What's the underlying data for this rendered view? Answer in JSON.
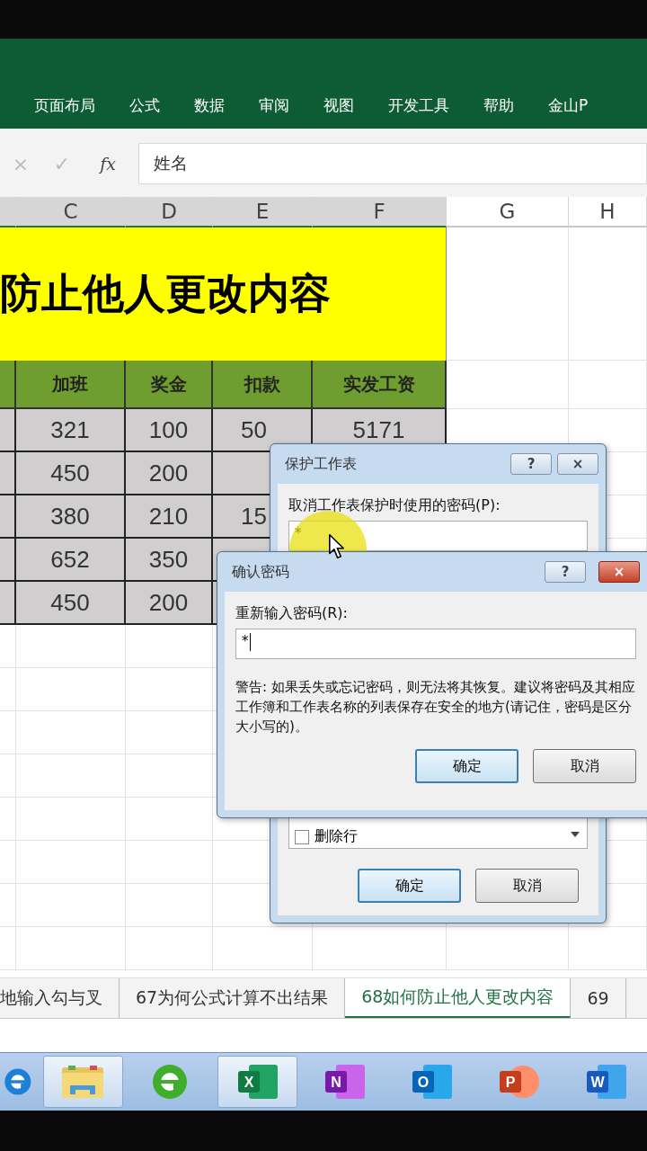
{
  "ribbon": {
    "tabs": [
      {
        "label": "页面布局",
        "selected": false
      },
      {
        "label": "公式",
        "selected": false
      },
      {
        "label": "数据",
        "selected": false
      },
      {
        "label": "审阅",
        "selected": false
      },
      {
        "label": "视图",
        "selected": false
      },
      {
        "label": "开发工具",
        "selected": false
      },
      {
        "label": "帮助",
        "selected": false
      },
      {
        "label": "金山P",
        "selected": false
      }
    ]
  },
  "formula_bar": {
    "cancel": "×",
    "enter": "✓",
    "function": "fx",
    "value": "姓名"
  },
  "columns": [
    "C",
    "D",
    "E",
    "F",
    "G",
    "H"
  ],
  "sheet": {
    "title": "防止他人更改内容",
    "headers": [
      "加班",
      "奖金",
      "扣款",
      "实发工资"
    ],
    "rows": [
      [
        "321",
        "100",
        "50",
        "5171"
      ],
      [
        "450",
        "200"
      ],
      [
        "380",
        "210",
        "15"
      ],
      [
        "652",
        "350"
      ],
      [
        "450",
        "200"
      ]
    ]
  },
  "protect_dialog": {
    "title": "保护工作表",
    "help": "?",
    "close": "×",
    "password_label": "取消工作表保护时使用的密码(P):",
    "password_value": "*",
    "options": [
      {
        "label": "删除行",
        "checked": false
      }
    ],
    "buttons": [
      {
        "label": "确定",
        "default": true
      },
      {
        "label": "取消",
        "default": false
      }
    ]
  },
  "confirm_dialog": {
    "title": "确认密码",
    "help": "?",
    "close": "×",
    "password_label": "重新输入密码(R):",
    "password_value": "*",
    "warning": "警告: 如果丢失或忘记密码，则无法将其恢复。建议将密码及其相应工作簿和工作表名称的列表保存在安全的地方(请记住，密码是区分大小写的)。",
    "buttons": [
      {
        "label": "确定",
        "default": true
      },
      {
        "label": "取消",
        "default": false
      }
    ]
  },
  "sheet_tabs": [
    {
      "label": "地输入勾与叉",
      "selected": false
    },
    {
      "label": "67为何公式计算不出结果",
      "selected": false
    },
    {
      "label": "68如何防止他人更改内容",
      "selected": true
    },
    {
      "label": "69",
      "selected": false
    }
  ],
  "taskbar": [
    {
      "kind": "ie",
      "selected": false
    },
    {
      "kind": "folder",
      "selected": true
    },
    {
      "kind": "browser360",
      "selected": false
    },
    {
      "kind": "excel",
      "letter": "X",
      "selected": true
    },
    {
      "kind": "onenote",
      "letter": "N",
      "selected": false
    },
    {
      "kind": "outlook",
      "letter": "O",
      "selected": false
    },
    {
      "kind": "powerpoint",
      "letter": "P",
      "selected": false
    },
    {
      "kind": "word",
      "letter": "W",
      "selected": false
    }
  ]
}
